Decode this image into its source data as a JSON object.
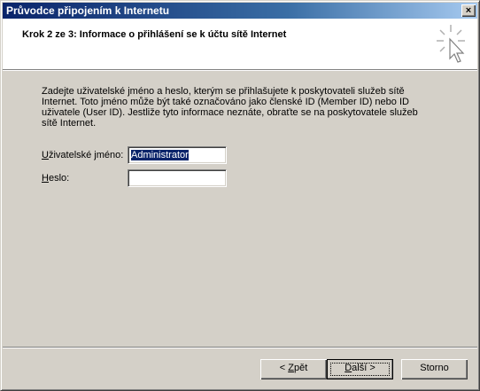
{
  "window": {
    "title": "Průvodce připojením k Internetu",
    "close_label": "×"
  },
  "header": {
    "step_title": "Krok 2 ze 3: Informace o přihlášení se k účtu sítě Internet"
  },
  "main": {
    "description": "Zadejte uživatelské jméno a heslo, kterým se přihlašujete k poskytovateli služeb sítě Internet. Toto jméno může být také označováno jako členské ID (Member ID) nebo ID uživatele (User ID). Jestliže tyto informace neznáte, obraťte se na poskytovatele služeb sítě Internet.",
    "username": {
      "label_pre": "",
      "label_accel": "U",
      "label_post": "živatelské jméno:",
      "value": "Administrator"
    },
    "password": {
      "label_pre": "",
      "label_accel": "H",
      "label_post": "eslo:",
      "value": ""
    }
  },
  "buttons": {
    "back_pre": "< ",
    "back_accel": "Z",
    "back_post": "pět",
    "next_pre": "",
    "next_accel": "D",
    "next_post": "alší >",
    "cancel": "Storno"
  },
  "icons": {
    "wizard": "wizard-cursor-sparkle-icon",
    "close": "close-icon"
  }
}
